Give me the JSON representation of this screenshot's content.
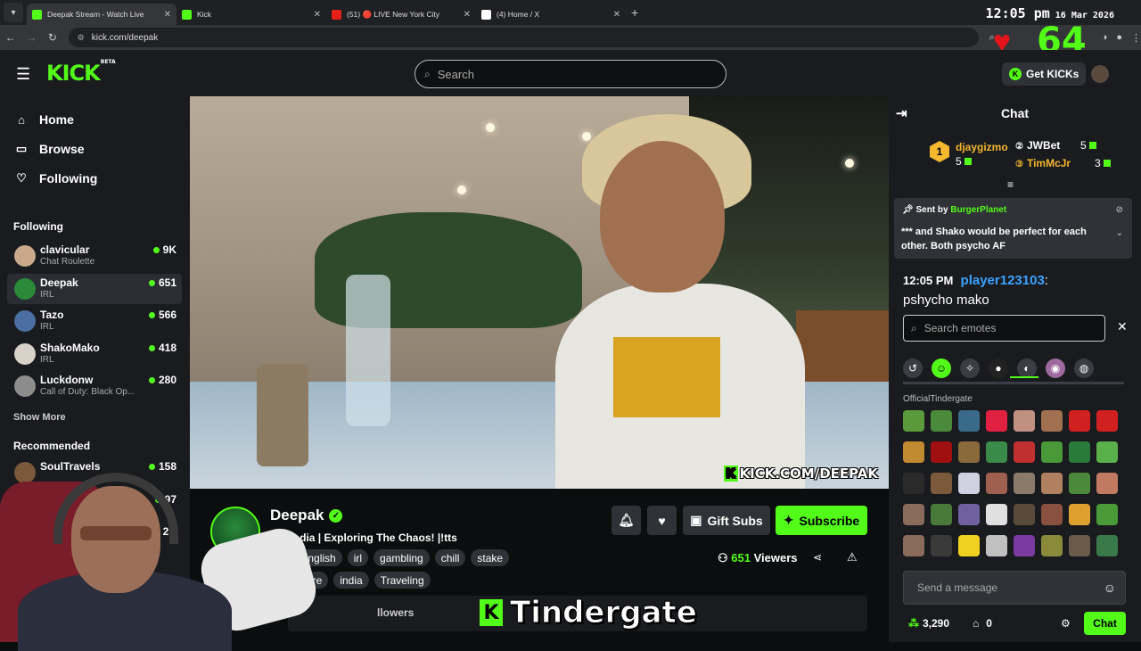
{
  "browser": {
    "tabs": [
      {
        "title": "Deepak Stream - Watch Live",
        "active": true,
        "fav_color": "#53fc18"
      },
      {
        "title": "Kick",
        "active": false,
        "fav_color": "#53fc18"
      },
      {
        "title": "(51) 🔴 LIVE New York City",
        "active": false,
        "fav_color": "#e62117"
      },
      {
        "title": "(4) Home / X",
        "active": false,
        "fav_color": "#ffffff"
      }
    ],
    "url": "kick.com/deepak",
    "clock_time": "12:05 pm",
    "clock_date": "16 Mar 2026"
  },
  "overlay": {
    "heart": "♥",
    "count": "64"
  },
  "header": {
    "logo": "KICK",
    "logo_badge": "BETA",
    "search_placeholder": "Search",
    "get_kicks": "Get KICKs"
  },
  "sidebar": {
    "nav": [
      {
        "label": "Home",
        "icon": "home-icon",
        "glyph": "⌂"
      },
      {
        "label": "Browse",
        "icon": "browse-icon",
        "glyph": "▭"
      },
      {
        "label": "Following",
        "icon": "heart-icon",
        "glyph": "♡"
      }
    ],
    "following_title": "Following",
    "following": [
      {
        "name": "clavicular",
        "category": "Chat Roulette",
        "viewers": "9K",
        "avatar": "#c9a98a",
        "active": false
      },
      {
        "name": "Deepak",
        "category": "IRL",
        "viewers": "651",
        "avatar": "#2b8a3a",
        "active": true
      },
      {
        "name": "Tazo",
        "category": "IRL",
        "viewers": "566",
        "avatar": "#4a6fa0",
        "active": false
      },
      {
        "name": "ShakoMako",
        "category": "IRL",
        "viewers": "418",
        "avatar": "#d8d2c8",
        "active": false
      },
      {
        "name": "Luckdonw",
        "category": "Call of Duty: Black Op...",
        "viewers": "280",
        "avatar": "#8c8c8c",
        "active": false
      }
    ],
    "show_more": "Show More",
    "recommended_title": "Recommended",
    "recommended": [
      {
        "name": "SoulTravels",
        "viewers": "158",
        "avatar": "#7a5a3a"
      },
      {
        "name": "",
        "viewers": "97",
        "avatar": "#d8c64a"
      },
      {
        "name": "",
        "viewers": "2K",
        "avatar": "#555555"
      }
    ]
  },
  "video": {
    "watermark": "KICK.COM/DEEPAK"
  },
  "stream": {
    "name": "Deepak",
    "title": "IRL India |  Exploring The Chaos! |!tts",
    "category": "IRL",
    "tags": [
      "English",
      "irl",
      "gambling",
      "chill",
      "stake"
    ],
    "tags_row2": [
      "ure",
      "india",
      "Traveling"
    ],
    "gift_subs": "Gift Subs",
    "subscribe": "Subscribe",
    "viewer_count": "651",
    "viewers_label": "Viewers",
    "followers_label": "llowers"
  },
  "caption": {
    "text": "Tindergate"
  },
  "chat": {
    "title": "Chat",
    "leaderboard": [
      {
        "name": "djaygizmo",
        "count": "5",
        "color": "#f5b82e",
        "rank": "1"
      },
      {
        "name": "JWBet",
        "count": "5",
        "color": "#ffffff",
        "rank": "2"
      },
      {
        "name": "TimMcJr",
        "count": "3",
        "color": "#f5b82e",
        "rank": "3"
      }
    ],
    "pinned_by_label": "Sent by",
    "pinned_by_user": "BurgerPlanet",
    "pinned_message": "*** and Shako would be perfect for each other. Both psycho AF",
    "message": {
      "time": "12:05 PM",
      "user": "player123103",
      "text": "pshycho mako"
    },
    "emote_search_placeholder": "Search emotes",
    "emote_section": "OfficialTindergate",
    "emote_colors": [
      "#5b9a3a",
      "#4a8a3a",
      "#3a6a8a",
      "#e02040",
      "#c09080",
      "#a07050",
      "#d02020",
      "#d02020",
      "#c08a30",
      "#a01010",
      "#8a6a3a",
      "#3a8a4a",
      "#c03030",
      "#4a9a3a",
      "#2a7a3a",
      "#5ab04a",
      "#2a2a2a",
      "#7a5a3a",
      "#d0d0e0",
      "#a06050",
      "#8a7a6a",
      "#b08060",
      "#4a8a3a",
      "#c07a60",
      "#8a6a5a",
      "#4a7a3a",
      "#7060a0",
      "#e0e0e0",
      "#5a4a3a",
      "#8a5040",
      "#e0a030",
      "#4a9a3a",
      "#8a6a5a",
      "#3a3a3a",
      "#f0d020",
      "#c0c0c0",
      "#7a3aa0",
      "#8a8a3a",
      "#6a5a4a",
      "#3a7a4a"
    ],
    "input_placeholder": "Send a message",
    "points": "3,290",
    "drops": "0",
    "send_label": "Chat"
  }
}
